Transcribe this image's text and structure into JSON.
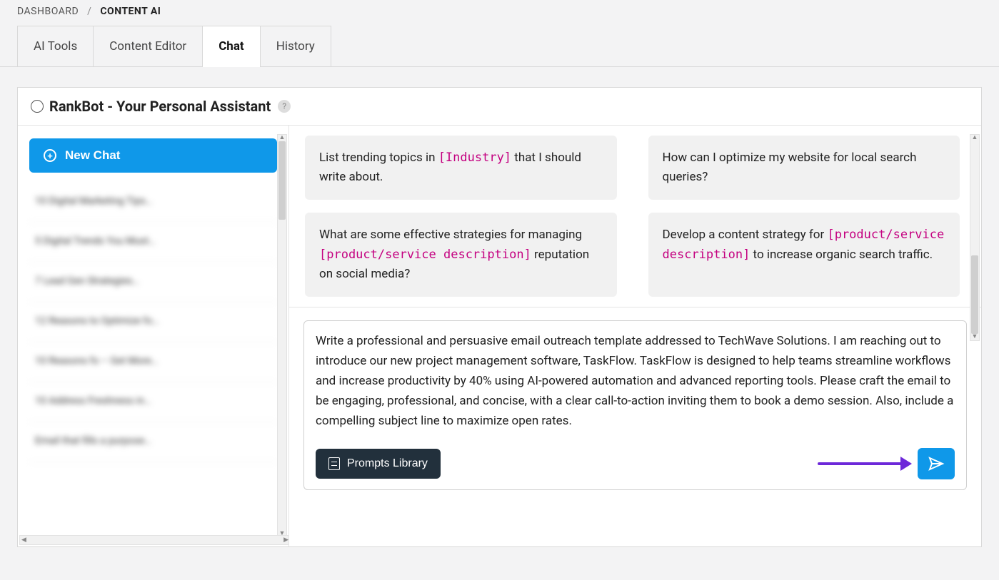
{
  "breadcrumb": {
    "root": "DASHBOARD",
    "sep": "/",
    "current": "CONTENT AI"
  },
  "tabs": {
    "ai_tools": "AI Tools",
    "content_editor": "Content Editor",
    "chat": "Chat",
    "history": "History"
  },
  "header": {
    "title": "RankBot - Your Personal Assistant",
    "help": "?"
  },
  "sidebar": {
    "new_chat": "New Chat",
    "history": [
      "10 Digital Marketing Tips…",
      "5 Digital Trends You Must…",
      "7 Lead Gen Strategies…",
      "12 Reasons to Optimize fo…",
      "10 Reasons fo – Get More…",
      "10 Address Freshness in…",
      "Email that fills a purpose…"
    ]
  },
  "prompts": {
    "p1_pre": "List trending topics in ",
    "p1_var": "[Industry]",
    "p1_post": " that I should write about.",
    "p2": "How can I optimize my website for local search queries?",
    "p3_pre": "What are some effective strategies for managing ",
    "p3_var": "[product/service description]",
    "p3_post": " reputation on social media?",
    "p4_pre": "Develop a content strategy for ",
    "p4_var": "[product/service description]",
    "p4_post": " to increase organic search traffic."
  },
  "compose": {
    "text": "Write a professional and persuasive email outreach template addressed to TechWave Solutions. I am reaching out to introduce our new project management software, TaskFlow. TaskFlow is designed to help teams streamline workflows and increase productivity by 40% using AI-powered automation and advanced reporting tools. Please craft the email to be engaging, professional, and concise, with a clear call-to-action inviting them to book a demo session. Also, include a compelling subject line to maximize open rates.",
    "prompts_library": "Prompts Library"
  }
}
